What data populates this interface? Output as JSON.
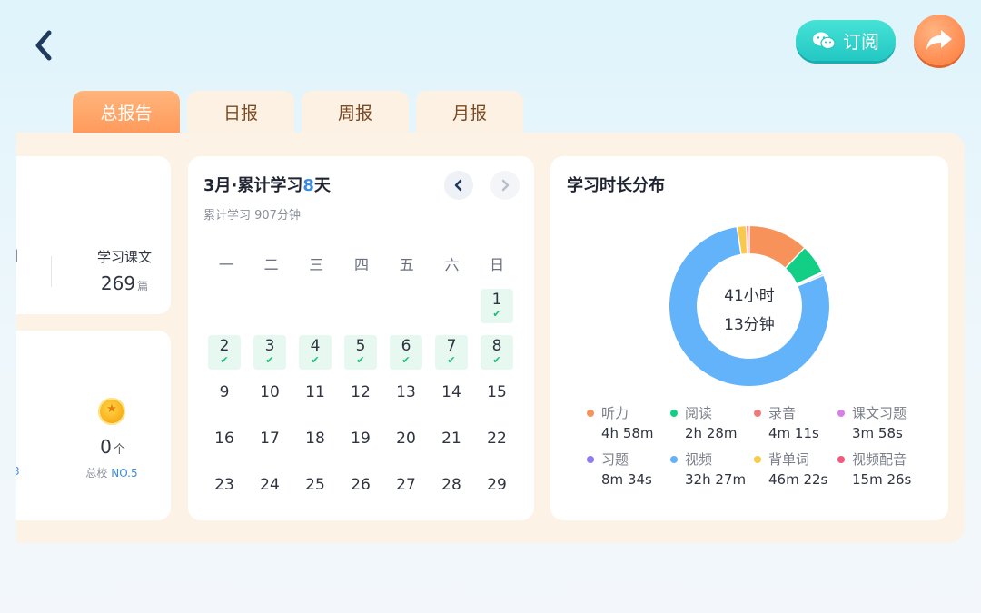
{
  "header": {
    "back_icon": "chevron-left-icon",
    "subscribe_label": "订阅",
    "subscribe_icon": "wechat-icon",
    "share_icon": "share-arrow-icon"
  },
  "tabs": [
    {
      "label": "总报告",
      "active": true
    },
    {
      "label": "日报",
      "active": false
    },
    {
      "label": "周报",
      "active": false
    },
    {
      "label": "月报",
      "active": false
    }
  ],
  "summary": {
    "cut_left_text": "]",
    "lessons_label": "学习课文",
    "lessons_value": "269",
    "lessons_unit": "篇",
    "medal_count": "0",
    "medal_unit": "个",
    "rank_prefix": "总校",
    "rank_value": "NO.5",
    "cut_rank_text": "3"
  },
  "calendar": {
    "title_prefix": "3月·累计学习",
    "title_days": "8",
    "title_suffix": "天",
    "subtitle": "累计学习 907分钟",
    "weekdays": [
      "一",
      "二",
      "三",
      "四",
      "五",
      "六",
      "日"
    ],
    "days": [
      {
        "n": "1",
        "done": true
      },
      {
        "n": "2",
        "done": true
      },
      {
        "n": "3",
        "done": true
      },
      {
        "n": "4",
        "done": true
      },
      {
        "n": "5",
        "done": true
      },
      {
        "n": "6",
        "done": true
      },
      {
        "n": "7",
        "done": true
      },
      {
        "n": "8",
        "done": true
      },
      {
        "n": "9",
        "done": false
      },
      {
        "n": "10",
        "done": false
      },
      {
        "n": "11",
        "done": false
      },
      {
        "n": "12",
        "done": false
      },
      {
        "n": "13",
        "done": false
      },
      {
        "n": "14",
        "done": false
      },
      {
        "n": "15",
        "done": false
      },
      {
        "n": "16",
        "done": false
      },
      {
        "n": "17",
        "done": false
      },
      {
        "n": "18",
        "done": false
      },
      {
        "n": "19",
        "done": false
      },
      {
        "n": "20",
        "done": false
      },
      {
        "n": "21",
        "done": false
      },
      {
        "n": "22",
        "done": false
      },
      {
        "n": "23",
        "done": false
      },
      {
        "n": "24",
        "done": false
      },
      {
        "n": "25",
        "done": false
      },
      {
        "n": "26",
        "done": false
      },
      {
        "n": "27",
        "done": false
      },
      {
        "n": "28",
        "done": false
      },
      {
        "n": "29",
        "done": false
      }
    ],
    "check_glyph": "✔"
  },
  "distribution": {
    "title": "学习时长分布",
    "center_line1": "41小时",
    "center_line2": "13分钟",
    "items": [
      {
        "name": "听力",
        "value": "4h 58m",
        "minutes": 298,
        "color": "#f7935a"
      },
      {
        "name": "阅读",
        "value": "2h 28m",
        "minutes": 148,
        "color": "#12cf85"
      },
      {
        "name": "录音",
        "value": "4m 11s",
        "minutes": 4.2,
        "color": "#ef7a7a"
      },
      {
        "name": "课文习题",
        "value": "3m 58s",
        "minutes": 4.0,
        "color": "#d67fe8"
      },
      {
        "name": "习题",
        "value": "8m 34s",
        "minutes": 8.6,
        "color": "#8d7cf0"
      },
      {
        "name": "视频",
        "value": "32h 27m",
        "minutes": 1947,
        "color": "#62b3fa"
      },
      {
        "name": "背单词",
        "value": "46m 22s",
        "minutes": 46.4,
        "color": "#f8c94a"
      },
      {
        "name": "视频配音",
        "value": "15m 26s",
        "minutes": 15.4,
        "color": "#ef5a7d"
      }
    ]
  }
}
